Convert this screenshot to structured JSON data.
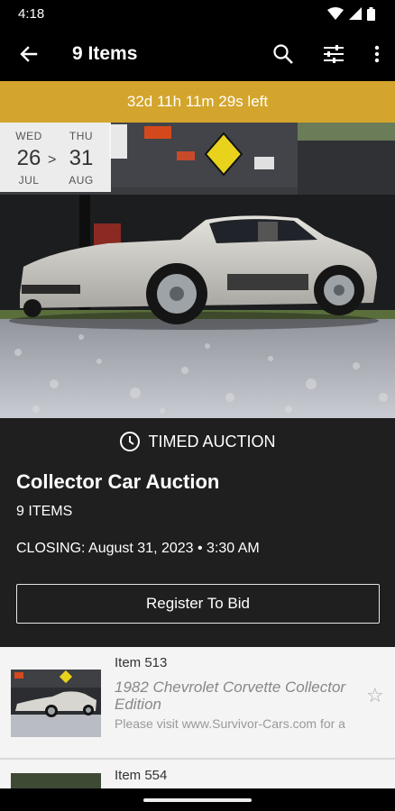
{
  "status_bar": {
    "time": "4:18",
    "icons": [
      "wifi-icon",
      "signal-icon",
      "battery-icon"
    ]
  },
  "app_bar": {
    "title": "9 Items",
    "actions": [
      "search-icon",
      "filter-sliders-icon",
      "more-vert-icon"
    ]
  },
  "countdown": {
    "text": "32d 11h 11m 29s left"
  },
  "date_range": {
    "start": {
      "dow": "WED",
      "day": "26",
      "month": "JUL"
    },
    "separator": ">",
    "end": {
      "dow": "THU",
      "day": "31",
      "month": "AUG"
    }
  },
  "auction": {
    "type": "TIMED AUCTION",
    "title": "Collector Car Auction",
    "item_count": "9 ITEMS",
    "closing": "CLOSING: August 31, 2023 • 3:30 AM",
    "register_label": "Register To Bid"
  },
  "lots": [
    {
      "number": "Item 513",
      "name": "1982 Chevrolet Corvette Collector Edition",
      "description": "Please visit www.Survivor-Cars.com for a"
    },
    {
      "number": "Item 554",
      "name": "",
      "description": ""
    }
  ],
  "colors": {
    "accent": "#d4a52c",
    "background": "#1f1f1f",
    "app_bar": "#000000",
    "list_bg": "#f4f4f4"
  }
}
